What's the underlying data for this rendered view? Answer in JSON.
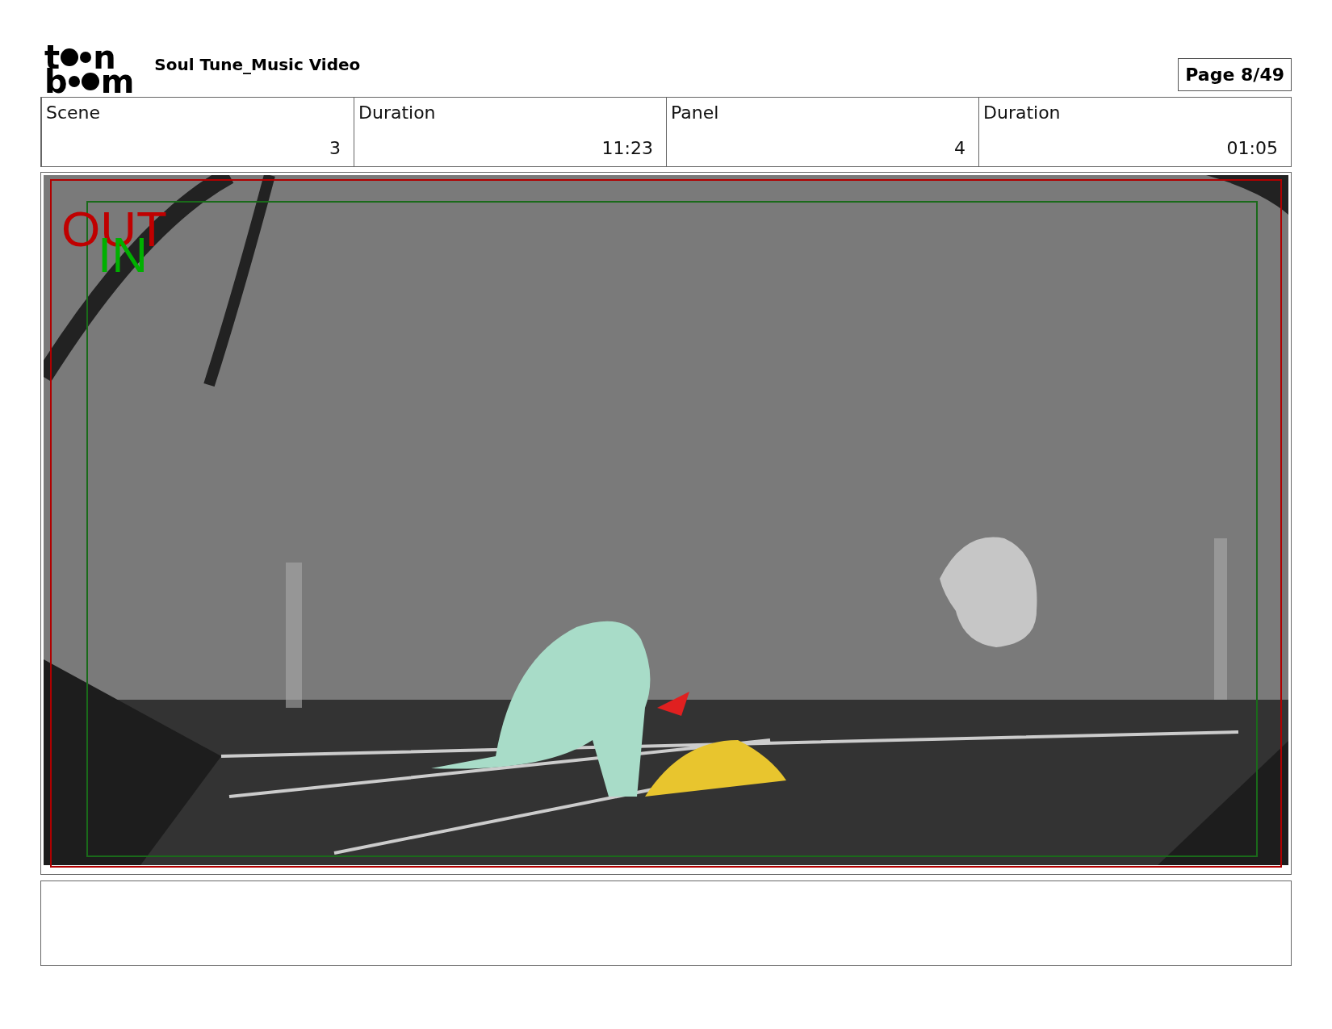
{
  "header": {
    "logo_rows": [
      {
        "lead": "t",
        "tail": "n"
      },
      {
        "lead": "b",
        "tail": "m"
      }
    ],
    "title": "Soul Tune_Music Video",
    "page_label": "Page",
    "page_number": "8/49"
  },
  "info": [
    {
      "label": "Scene",
      "value": "3"
    },
    {
      "label": "Duration",
      "value": "11:23"
    },
    {
      "label": "Panel",
      "value": "4"
    },
    {
      "label": "Duration",
      "value": "01:05"
    }
  ],
  "panel": {
    "frame_marks": [
      {
        "label": "OUT",
        "color": "#c00000"
      },
      {
        "label": "IN",
        "color": "#00b000"
      }
    ]
  }
}
